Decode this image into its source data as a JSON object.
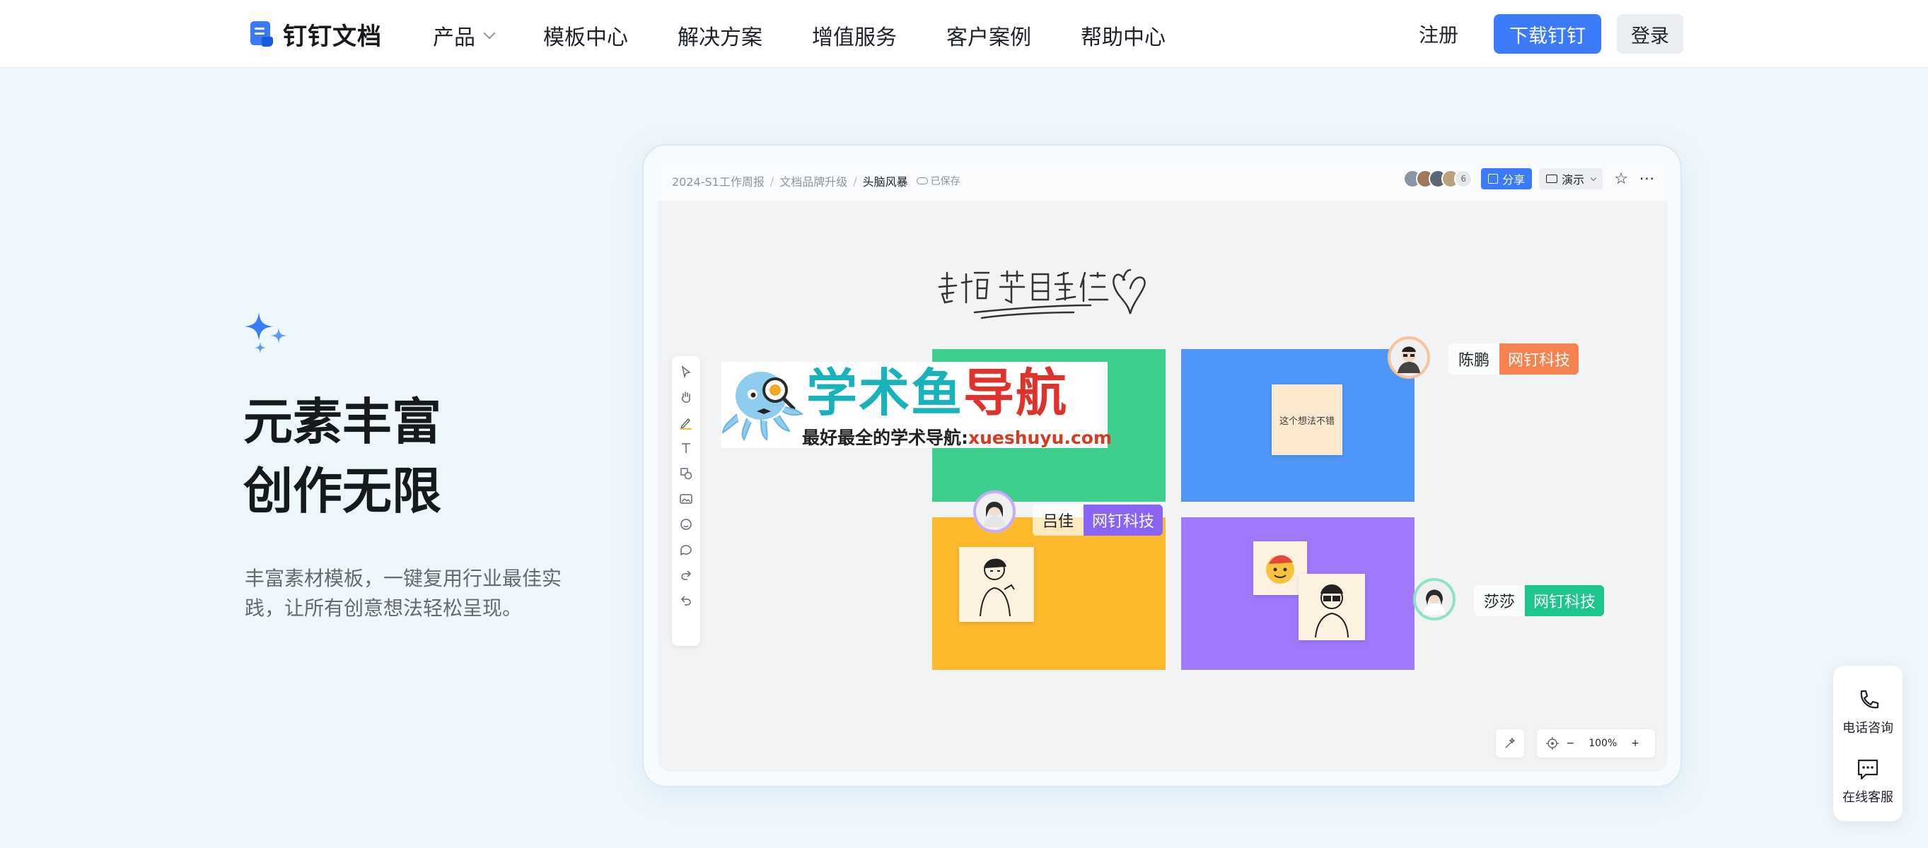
{
  "brand": {
    "name": "钉钉文档"
  },
  "nav": {
    "menu": [
      {
        "label": "产品",
        "has_dropdown": true
      },
      {
        "label": "模板中心"
      },
      {
        "label": "解决方案"
      },
      {
        "label": "增值服务"
      },
      {
        "label": "客户案例"
      },
      {
        "label": "帮助中心"
      }
    ],
    "register": "注册",
    "download": "下载钉钉",
    "login": "登录"
  },
  "hero": {
    "title_line1": "元素丰富",
    "title_line2": "创作无限",
    "description": "丰富素材模板，一键复用行业最佳实践，让所有创意想法轻松呈现。"
  },
  "preview": {
    "breadcrumbs": [
      "2024-S1工作周报",
      "文档品牌升级",
      "头脑风暴"
    ],
    "saved": "已保存",
    "collaborator_count": "6",
    "share": "分享",
    "present": "演示",
    "sticky_note": "这个想法不错",
    "zoom": "100%",
    "users": [
      {
        "name": "陈鹏",
        "company": "网钉科技",
        "color": "#f7824d"
      },
      {
        "name": "吕佳",
        "company": "网钉科技",
        "color": "#8b63f5"
      },
      {
        "name": "莎莎",
        "company": "网钉科技",
        "color": "#1fc58e"
      }
    ]
  },
  "watermark": {
    "title_part1": "学术鱼",
    "title_part2": "导航",
    "subtitle": "最好最全的学术导航:",
    "url": "xueshuyu.com"
  },
  "float_service": {
    "phone": "电话咨询",
    "online": "在线客服"
  },
  "colors": {
    "accent": "#3a7bfb",
    "background": "#eef7fb"
  }
}
